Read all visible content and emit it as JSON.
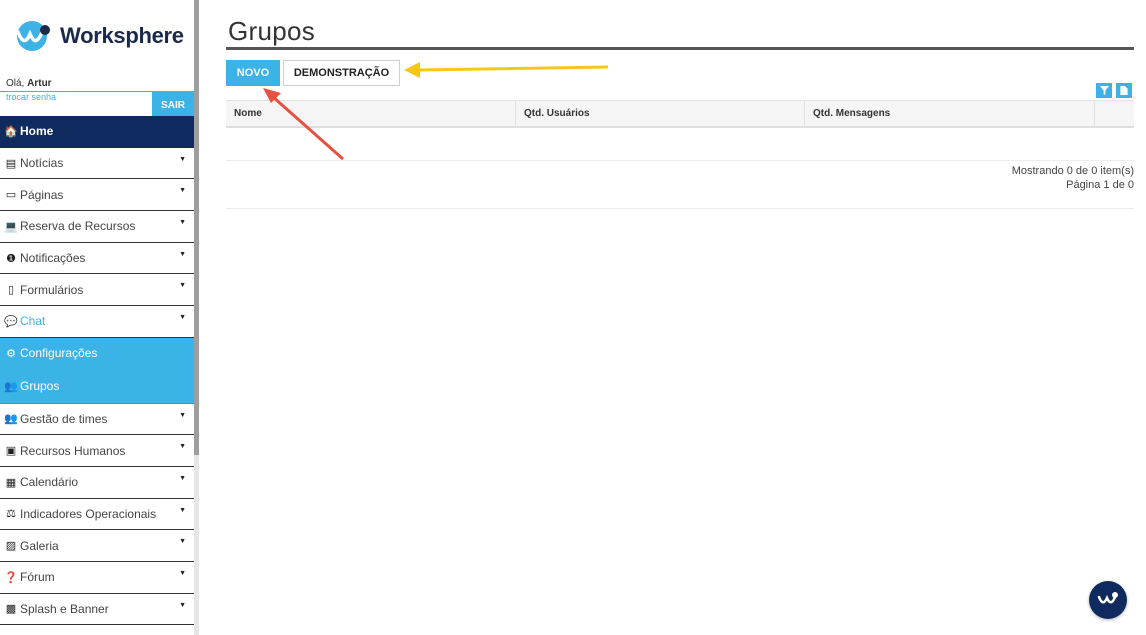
{
  "brand": {
    "name": "Worksphere"
  },
  "user": {
    "greeting_prefix": "Olá,",
    "name": "Artur",
    "change_password": "trocar senha",
    "logout": "SAIR"
  },
  "menu": [
    {
      "label": "Home",
      "icon": "home-icon",
      "glyph": "🏠",
      "state": "home"
    },
    {
      "label": "Notícias",
      "icon": "newspaper-icon",
      "glyph": "▤",
      "state": "normal",
      "caret": true
    },
    {
      "label": "Páginas",
      "icon": "window-icon",
      "glyph": "▭",
      "state": "normal",
      "caret": true
    },
    {
      "label": "Reserva de Recursos",
      "icon": "laptop-icon",
      "glyph": "💻",
      "state": "normal",
      "caret": true
    },
    {
      "label": "Notificações",
      "icon": "alert-circle-icon",
      "glyph": "❶",
      "state": "normal",
      "caret": true
    },
    {
      "label": "Formulários",
      "icon": "document-icon",
      "glyph": "▯",
      "state": "normal",
      "caret": true
    },
    {
      "label": "Chat",
      "icon": "chat-bubbles-icon",
      "glyph": "💬",
      "state": "chat",
      "caret": true
    },
    {
      "label": "Configurações",
      "icon": "gear-icon",
      "glyph": "⚙",
      "state": "active"
    },
    {
      "label": "Grupos",
      "icon": "users-icon",
      "glyph": "👥",
      "state": "active2"
    },
    {
      "label": "Gestão de times",
      "icon": "users-icon",
      "glyph": "👥",
      "state": "normal",
      "caret": true
    },
    {
      "label": "Recursos Humanos",
      "icon": "id-badge-icon",
      "glyph": "▣",
      "state": "normal",
      "caret": true
    },
    {
      "label": "Calendário",
      "icon": "calendar-icon",
      "glyph": "▦",
      "state": "normal",
      "caret": true
    },
    {
      "label": "Indicadores Operacionais",
      "icon": "balance-scale-icon",
      "glyph": "⚖",
      "state": "normal",
      "caret": true
    },
    {
      "label": "Galeria",
      "icon": "image-icon",
      "glyph": "▨",
      "state": "normal",
      "caret": true
    },
    {
      "label": "Fórum",
      "icon": "question-circle-icon",
      "glyph": "❓",
      "state": "normal",
      "caret": true
    },
    {
      "label": "Splash e Banner",
      "icon": "frame-icon",
      "glyph": "▩",
      "state": "normal",
      "caret": true
    }
  ],
  "page": {
    "title": "Grupos"
  },
  "actions": {
    "new_label": "NOVO",
    "demo_label": "DEMONSTRAÇÃO"
  },
  "grid": {
    "columns": [
      "Nome",
      "Qtd. Usuários",
      "Qtd. Mensagens"
    ],
    "rows": [],
    "showing": "Mostrando 0 de 0 item(s)",
    "page": "Página 1 de 0"
  },
  "colors": {
    "accent": "#3cb3e7",
    "navy": "#0f2a5e",
    "annotation_red": "#e8513f",
    "annotation_yellow": "#f5c71a"
  }
}
